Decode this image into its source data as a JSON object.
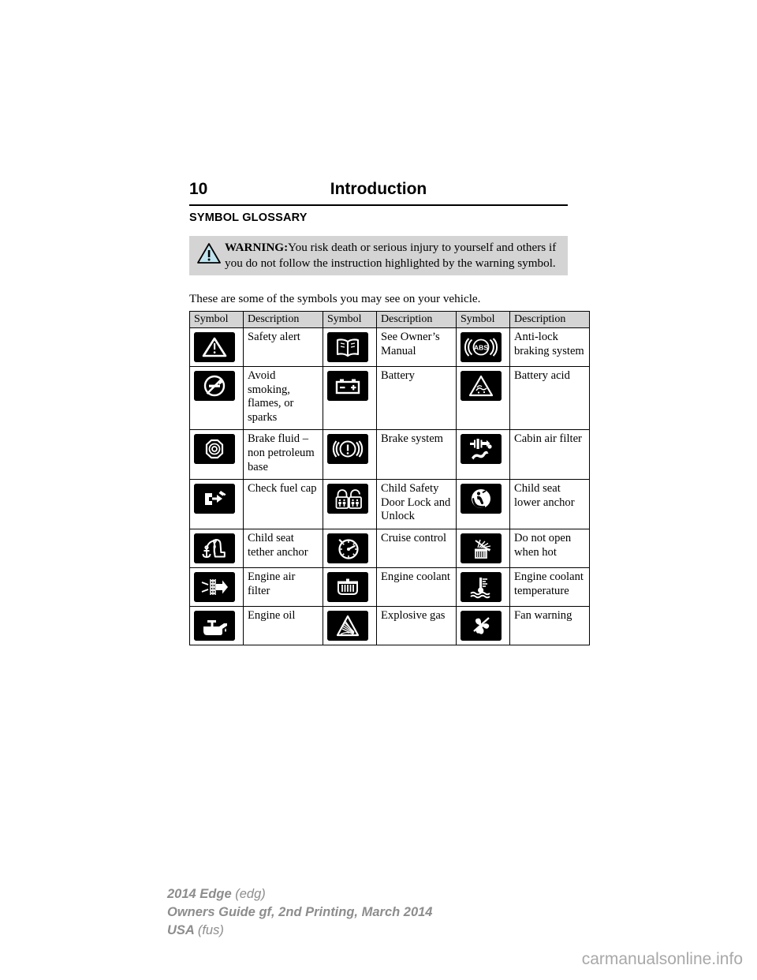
{
  "header": {
    "page_number": "10",
    "title": "Introduction"
  },
  "section_heading": "SYMBOL GLOSSARY",
  "warning": {
    "label": "WARNING:",
    "text": "You risk death or serious injury to yourself and others if you do not follow the instruction highlighted by the warning symbol.",
    "icon": "warning-triangle-icon",
    "box_color": "#d4d4d4",
    "icon_fill": "#bfe4f0"
  },
  "intro_line": "These are some of the symbols you may see on your vehicle.",
  "table": {
    "headers": [
      "Symbol",
      "Description",
      "Symbol",
      "Description",
      "Symbol",
      "Description"
    ],
    "rows": [
      [
        {
          "icon": "safety-alert-icon",
          "label": "Safety alert"
        },
        {
          "icon": "owners-manual-book-icon",
          "label": "See Owner’s Manual"
        },
        {
          "icon": "anti-lock-braking-abs-icon",
          "label": "Anti-lock braking system"
        }
      ],
      [
        {
          "icon": "no-smoking-no-flames-icon",
          "label": "Avoid smoking, flames, or sparks"
        },
        {
          "icon": "battery-icon",
          "label": "Battery"
        },
        {
          "icon": "battery-acid-icon",
          "label": "Battery acid"
        }
      ],
      [
        {
          "icon": "brake-fluid-icon",
          "label": "Brake fluid – non petroleum base"
        },
        {
          "icon": "brake-system-icon",
          "label": "Brake system"
        },
        {
          "icon": "cabin-air-filter-icon",
          "label": "Cabin air filter"
        }
      ],
      [
        {
          "icon": "check-fuel-cap-icon",
          "label": "Check fuel cap"
        },
        {
          "icon": "child-safety-door-lock-icon",
          "label": "Child Safety Door Lock and Unlock"
        },
        {
          "icon": "child-seat-lower-anchor-icon",
          "label": "Child seat lower anchor"
        }
      ],
      [
        {
          "icon": "child-seat-tether-anchor-icon",
          "label": "Child seat tether anchor"
        },
        {
          "icon": "cruise-control-icon",
          "label": "Cruise control"
        },
        {
          "icon": "do-not-open-when-hot-icon",
          "label": "Do not open when hot"
        }
      ],
      [
        {
          "icon": "engine-air-filter-icon",
          "label": "Engine air filter"
        },
        {
          "icon": "engine-coolant-icon",
          "label": "Engine coolant"
        },
        {
          "icon": "engine-coolant-temperature-icon",
          "label": "Engine coolant temperature"
        }
      ],
      [
        {
          "icon": "engine-oil-icon",
          "label": "Engine oil"
        },
        {
          "icon": "explosive-gas-icon",
          "label": "Explosive gas"
        },
        {
          "icon": "fan-warning-icon",
          "label": "Fan warning"
        }
      ]
    ]
  },
  "footer": {
    "line1_bold": "2014 Edge",
    "line1_paren": "(edg)",
    "line2": "Owners Guide gf, 2nd Printing, March 2014",
    "line3_bold": "USA",
    "line3_paren": "(fus)",
    "color": "#8d8d8d"
  },
  "watermark": "carmanualsonline.info"
}
